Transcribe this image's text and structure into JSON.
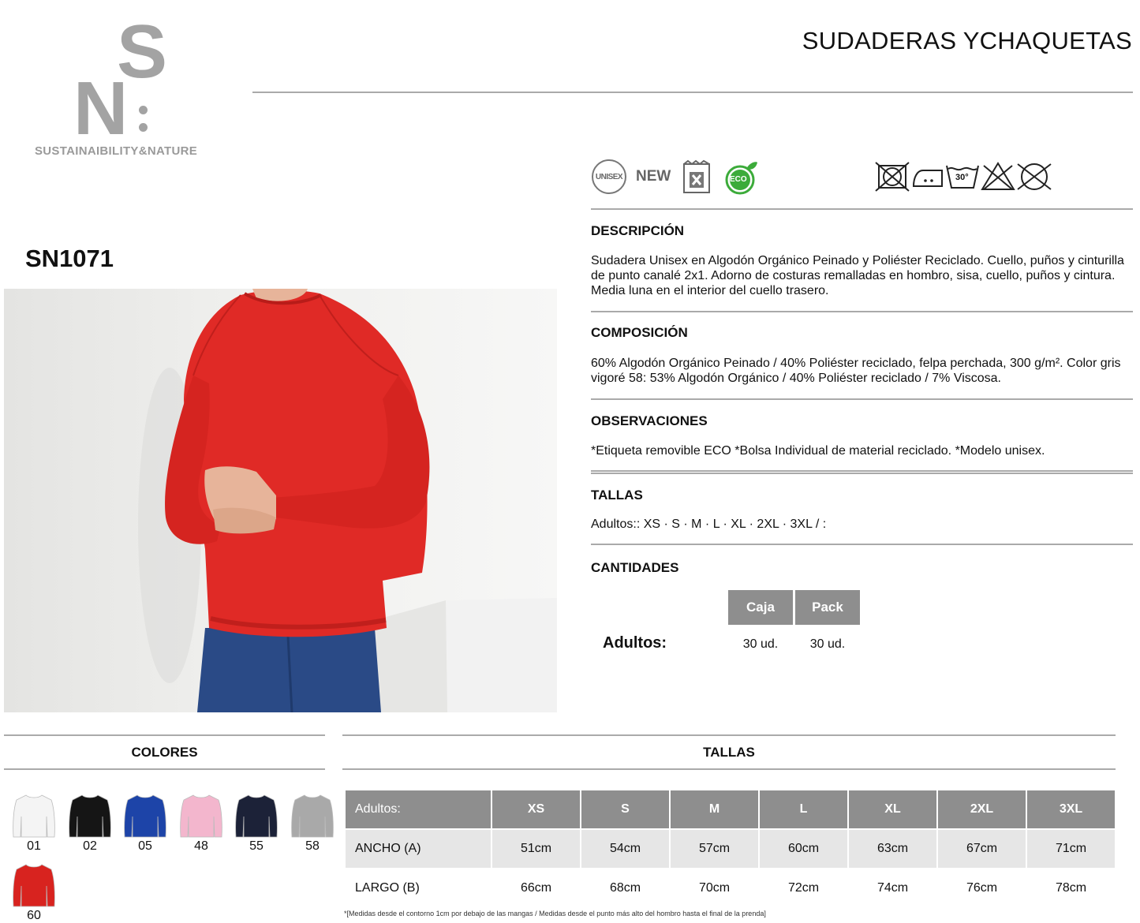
{
  "brand": {
    "monogram_top": "S",
    "monogram_bottom": "N",
    "tagline": "SUSTAINAIBILITY&NATURE"
  },
  "header": {
    "title": "SUDADERAS YCHAQUETAS"
  },
  "product": {
    "code": "SN1071"
  },
  "badges": {
    "unisex": "UNISEX",
    "new": "NEW",
    "eco": "ECO"
  },
  "care": {
    "wash_temp": "30°"
  },
  "sections": {
    "descripcion": {
      "title": "DESCRIPCIÓN",
      "text": "Sudadera Unisex en Algodón Orgánico Peinado y Poliéster Reciclado. Cuello, puños y cinturilla de punto canalé 2x1. Adorno de costuras remalladas en hombro, sisa, cuello, puños y cintura. Media luna en el interior del cuello trasero."
    },
    "composicion": {
      "title": "COMPOSICIÓN",
      "text": "60% Algodón Orgánico Peinado / 40% Poliéster reciclado, felpa perchada, 300 g/m². Color gris vigoré 58: 53% Algodón Orgánico / 40% Poliéster reciclado / 7% Viscosa."
    },
    "observaciones": {
      "title": "OBSERVACIONES",
      "text": "*Etiqueta removible ECO *Bolsa Individual de material reciclado. *Modelo unisex."
    },
    "tallas": {
      "title": "TALLAS",
      "text": "Adultos:: XS · S · M · L · XL · 2XL · 3XL / :"
    },
    "cantidades": {
      "title": "CANTIDADES",
      "row_label": "Adultos:",
      "columns": [
        "Caja",
        "Pack"
      ],
      "values": [
        "30 ud.",
        "30 ud."
      ]
    }
  },
  "colores": {
    "title": "COLORES",
    "items": [
      {
        "code": "01",
        "color": "#f4f4f4"
      },
      {
        "code": "02",
        "color": "#151515"
      },
      {
        "code": "05",
        "color": "#1d44a8"
      },
      {
        "code": "48",
        "color": "#f3b6cd"
      },
      {
        "code": "55",
        "color": "#1c2238"
      },
      {
        "code": "58",
        "color": "#a9a9a9"
      },
      {
        "code": "60",
        "color": "#d8231f"
      }
    ]
  },
  "size_table": {
    "title": "TALLAS",
    "header_label": "Adultos:",
    "sizes": [
      "XS",
      "S",
      "M",
      "L",
      "XL",
      "2XL",
      "3XL"
    ],
    "rows": [
      {
        "label": "ANCHO (A)",
        "values": [
          "51cm",
          "54cm",
          "57cm",
          "60cm",
          "63cm",
          "67cm",
          "71cm"
        ]
      },
      {
        "label": "LARGO (B)",
        "values": [
          "66cm",
          "68cm",
          "70cm",
          "72cm",
          "74cm",
          "76cm",
          "78cm"
        ]
      }
    ],
    "footnote": "*[Medidas desde el contorno 1cm por debajo de las mangas / Medidas desde el punto más alto del hombro hasta el final de la prenda]"
  },
  "colors": {
    "rule": "#aaaaaa",
    "header_cell": "#8e8e8e",
    "logo_gray": "#a3a3a3",
    "garment_red": "#e02a26",
    "eco_green": "#3cab3a"
  },
  "icons": [
    "unisex-badge-icon",
    "new-badge-icon",
    "removable-label-icon",
    "eco-leaf-icon",
    "no-dry-clean-icon",
    "iron-low-icon",
    "wash-30-icon",
    "no-bleach-icon",
    "no-tumble-dry-icon"
  ]
}
